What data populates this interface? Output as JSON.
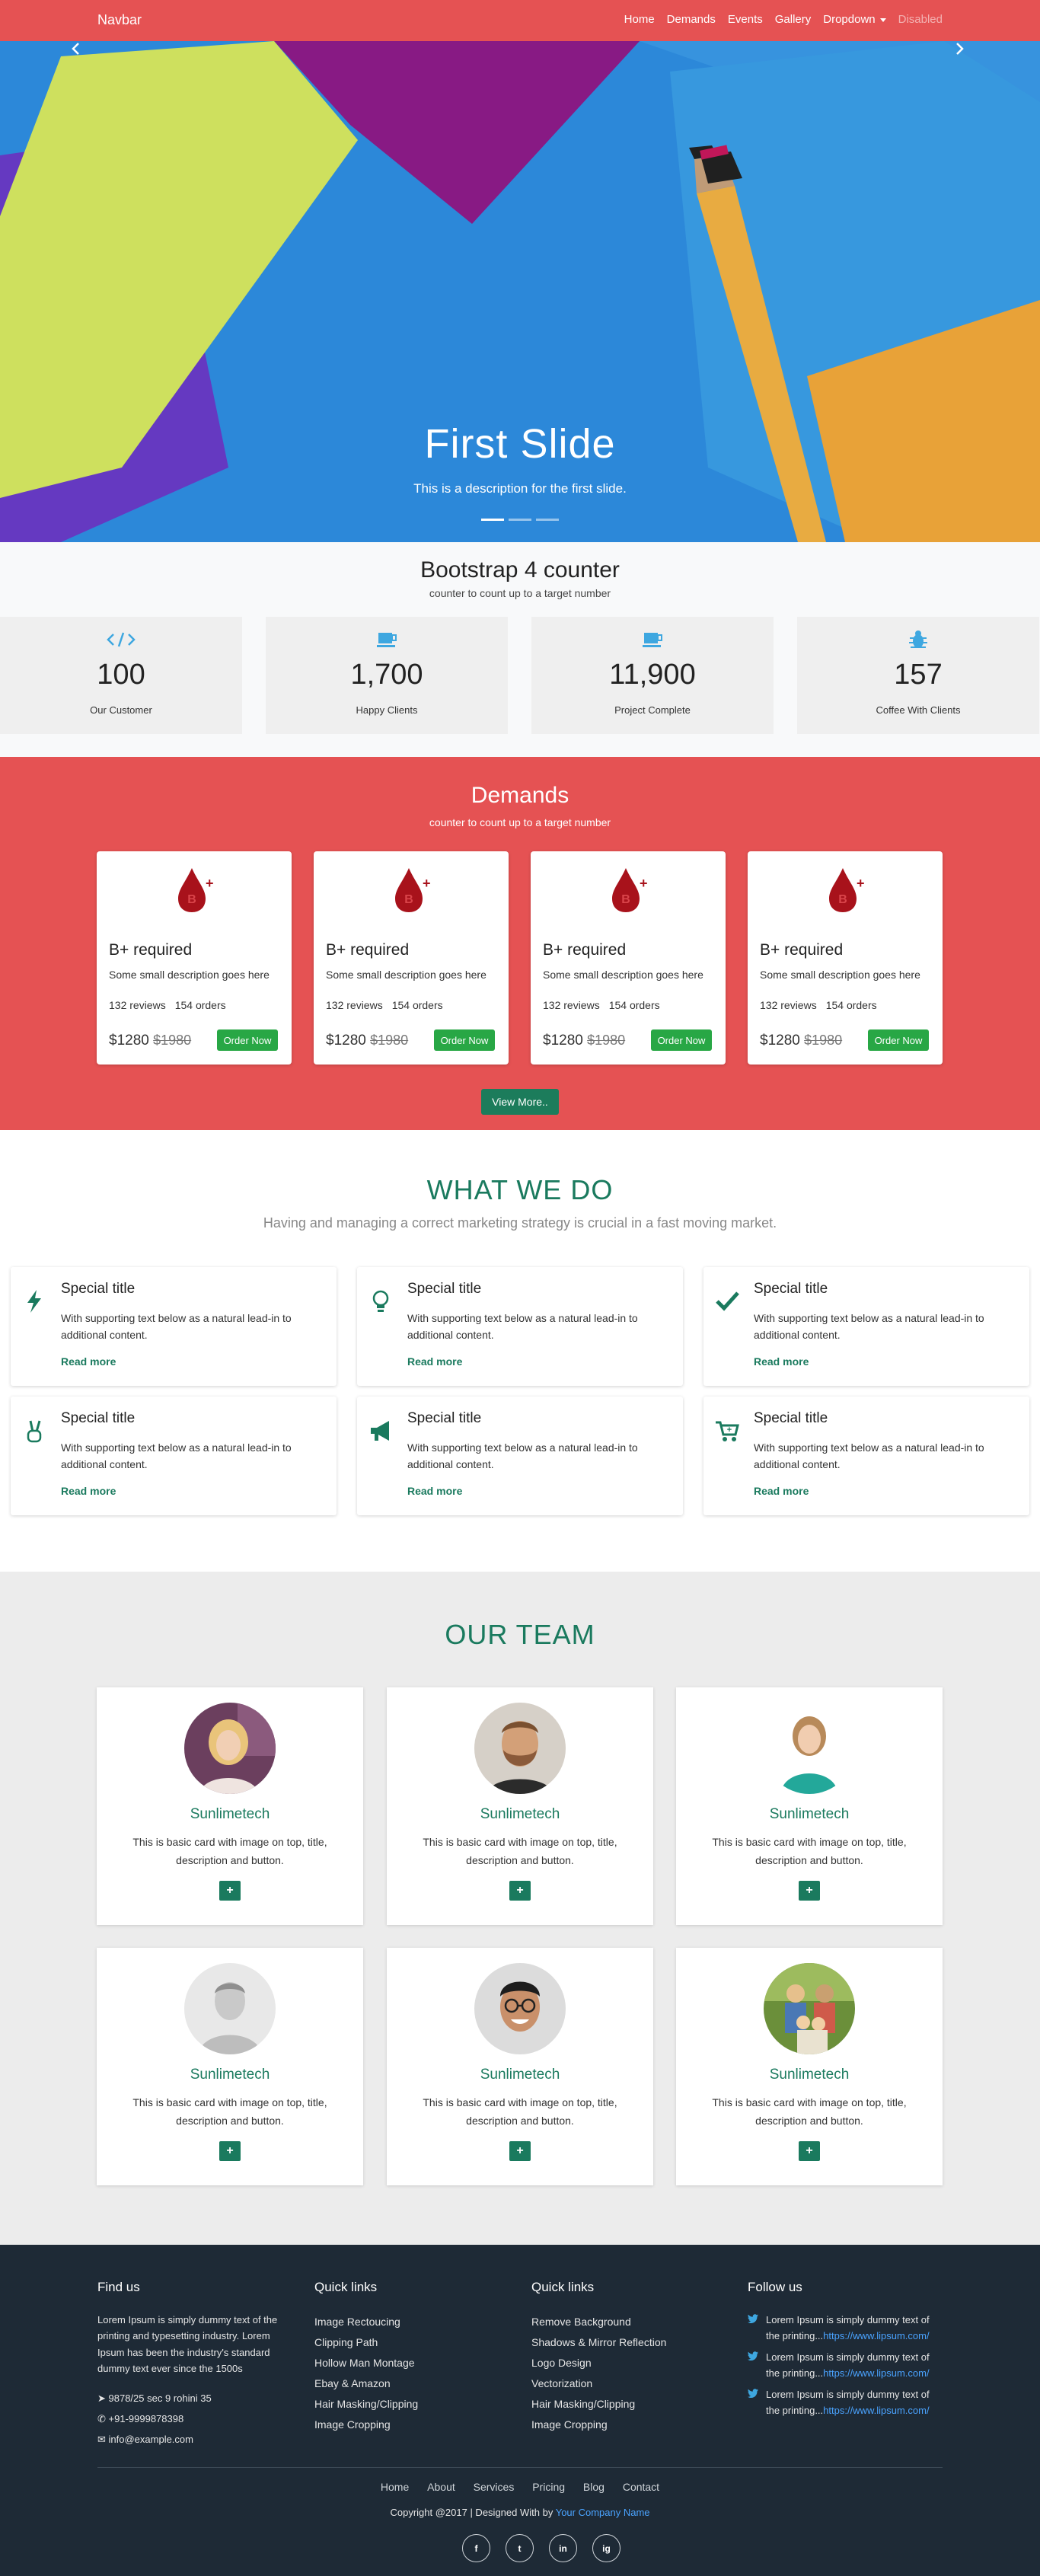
{
  "navbar": {
    "brand": "Navbar",
    "links": [
      "Home",
      "Demands",
      "Events",
      "Gallery"
    ],
    "dropdown": "Dropdown",
    "disabled": "Disabled"
  },
  "hero": {
    "title": "First Slide",
    "description": "This is a description for the first slide.",
    "slides": 3,
    "active_slide": 1
  },
  "counter": {
    "title": "Bootstrap 4 counter",
    "subtitle": "counter to count up to a target number",
    "items": [
      {
        "icon": "code-icon",
        "value": "100",
        "label": "Our Customer"
      },
      {
        "icon": "coffee-icon",
        "value": "1,700",
        "label": "Happy Clients"
      },
      {
        "icon": "coffee-icon",
        "value": "11,900",
        "label": "Project Complete"
      },
      {
        "icon": "bug-icon",
        "value": "157",
        "label": "Coffee With Clients"
      }
    ]
  },
  "demands": {
    "title": "Demands",
    "subtitle": "counter to count up to a target number",
    "cards": [
      {
        "title": "B+ required",
        "desc": "Some small description goes here",
        "reviews": "132 reviews",
        "orders": "154 orders",
        "price": "$1280",
        "old_price": "$1980",
        "button": "Order Now"
      },
      {
        "title": "B+ required",
        "desc": "Some small description goes here",
        "reviews": "132 reviews",
        "orders": "154 orders",
        "price": "$1280",
        "old_price": "$1980",
        "button": "Order Now"
      },
      {
        "title": "B+ required",
        "desc": "Some small description goes here",
        "reviews": "132 reviews",
        "orders": "154 orders",
        "price": "$1280",
        "old_price": "$1980",
        "button": "Order Now"
      },
      {
        "title": "B+ required",
        "desc": "Some small description goes here",
        "reviews": "132 reviews",
        "orders": "154 orders",
        "price": "$1280",
        "old_price": "$1980",
        "button": "Order Now"
      }
    ],
    "view_more": "View More.."
  },
  "what": {
    "title": "WHAT WE DO",
    "subtitle": "Having and managing a correct marketing strategy is crucial in a fast moving market.",
    "cards": [
      {
        "icon": "bolt-icon",
        "title": "Special title",
        "text": "With supporting text below as a natural lead-in to additional content.",
        "link": "Read more"
      },
      {
        "icon": "lightbulb-icon",
        "title": "Special title",
        "text": "With supporting text below as a natural lead-in to additional content.",
        "link": "Read more"
      },
      {
        "icon": "check-icon",
        "title": "Special title",
        "text": "With supporting text below as a natural lead-in to additional content.",
        "link": "Read more"
      },
      {
        "icon": "peace-hand-icon",
        "title": "Special title",
        "text": "With supporting text below as a natural lead-in to additional content.",
        "link": "Read more"
      },
      {
        "icon": "megaphone-icon",
        "title": "Special title",
        "text": "With supporting text below as a natural lead-in to additional content.",
        "link": "Read more"
      },
      {
        "icon": "cart-icon",
        "title": "Special title",
        "text": "With supporting text below as a natural lead-in to additional content.",
        "link": "Read more"
      }
    ]
  },
  "team": {
    "title": "OUR TEAM",
    "members": [
      {
        "name": "Sunlimetech",
        "desc": "This is basic card with image on top, title, description and button.",
        "avatar": "woman-blonde-avatar"
      },
      {
        "name": "Sunlimetech",
        "desc": "This is basic card with image on top, title, description and button.",
        "avatar": "man-bearded-avatar"
      },
      {
        "name": "Sunlimetech",
        "desc": "This is basic card with image on top, title, description and button.",
        "avatar": "woman-smiling-avatar"
      },
      {
        "name": "Sunlimetech",
        "desc": "This is basic card with image on top, title, description and button.",
        "avatar": "man-grey-avatar"
      },
      {
        "name": "Sunlimetech",
        "desc": "This is basic card with image on top, title, description and button.",
        "avatar": "man-glasses-avatar"
      },
      {
        "name": "Sunlimetech",
        "desc": "This is basic card with image on top, title, description and button.",
        "avatar": "family-avatar"
      }
    ],
    "button": "+"
  },
  "footer": {
    "find_us": {
      "title": "Find us",
      "text": "Lorem Ipsum is simply dummy text of the printing and typesetting industry. Lorem Ipsum has been the industry's standard dummy text ever since the 1500s",
      "address": "9878/25 sec 9 rohini 35",
      "phone": "+91-9999878398",
      "email": "info@example.com"
    },
    "quick1": {
      "title": "Quick links",
      "links": [
        "Image Rectoucing",
        "Clipping Path",
        "Hollow Man Montage",
        "Ebay & Amazon",
        "Hair Masking/Clipping",
        "Image Cropping"
      ]
    },
    "quick2": {
      "title": "Quick links",
      "links": [
        "Remove Background",
        "Shadows & Mirror Reflection",
        "Logo Design",
        "Vectorization",
        "Hair Masking/Clipping",
        "Image Cropping"
      ]
    },
    "follow": {
      "title": "Follow us",
      "tweets": [
        {
          "text": "Lorem Ipsum is simply dummy text of the printing...",
          "link": "https://www.lipsum.com/"
        },
        {
          "text": "Lorem Ipsum is simply dummy text of the printing...",
          "link": "https://www.lipsum.com/"
        },
        {
          "text": "Lorem Ipsum is simply dummy text of the printing...",
          "link": "https://www.lipsum.com/"
        }
      ]
    },
    "nav": [
      "Home",
      "About",
      "Services",
      "Pricing",
      "Blog",
      "Contact"
    ],
    "copyright": "Copyright @2017 | Designed With by",
    "company": "Your Company Name",
    "social": [
      "f",
      "t",
      "in",
      "ig"
    ]
  },
  "colors": {
    "brand_red": "#e55253",
    "accent_green": "#1a7a5e",
    "button_green": "#28a745",
    "footer_bg": "#1e2a36"
  }
}
